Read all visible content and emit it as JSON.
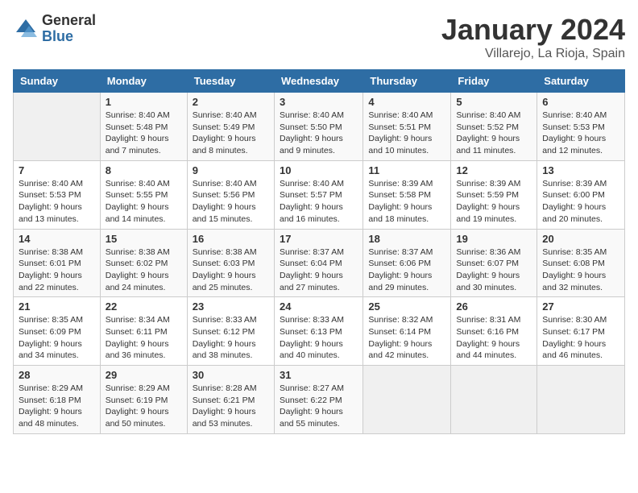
{
  "logo": {
    "general": "General",
    "blue": "Blue"
  },
  "title": "January 2024",
  "location": "Villarejo, La Rioja, Spain",
  "days_of_week": [
    "Sunday",
    "Monday",
    "Tuesday",
    "Wednesday",
    "Thursday",
    "Friday",
    "Saturday"
  ],
  "weeks": [
    [
      {
        "day": "",
        "sunrise": "",
        "sunset": "",
        "daylight": ""
      },
      {
        "day": "1",
        "sunrise": "Sunrise: 8:40 AM",
        "sunset": "Sunset: 5:48 PM",
        "daylight": "Daylight: 9 hours and 7 minutes."
      },
      {
        "day": "2",
        "sunrise": "Sunrise: 8:40 AM",
        "sunset": "Sunset: 5:49 PM",
        "daylight": "Daylight: 9 hours and 8 minutes."
      },
      {
        "day": "3",
        "sunrise": "Sunrise: 8:40 AM",
        "sunset": "Sunset: 5:50 PM",
        "daylight": "Daylight: 9 hours and 9 minutes."
      },
      {
        "day": "4",
        "sunrise": "Sunrise: 8:40 AM",
        "sunset": "Sunset: 5:51 PM",
        "daylight": "Daylight: 9 hours and 10 minutes."
      },
      {
        "day": "5",
        "sunrise": "Sunrise: 8:40 AM",
        "sunset": "Sunset: 5:52 PM",
        "daylight": "Daylight: 9 hours and 11 minutes."
      },
      {
        "day": "6",
        "sunrise": "Sunrise: 8:40 AM",
        "sunset": "Sunset: 5:53 PM",
        "daylight": "Daylight: 9 hours and 12 minutes."
      }
    ],
    [
      {
        "day": "7",
        "sunrise": "Sunrise: 8:40 AM",
        "sunset": "Sunset: 5:53 PM",
        "daylight": "Daylight: 9 hours and 13 minutes."
      },
      {
        "day": "8",
        "sunrise": "Sunrise: 8:40 AM",
        "sunset": "Sunset: 5:55 PM",
        "daylight": "Daylight: 9 hours and 14 minutes."
      },
      {
        "day": "9",
        "sunrise": "Sunrise: 8:40 AM",
        "sunset": "Sunset: 5:56 PM",
        "daylight": "Daylight: 9 hours and 15 minutes."
      },
      {
        "day": "10",
        "sunrise": "Sunrise: 8:40 AM",
        "sunset": "Sunset: 5:57 PM",
        "daylight": "Daylight: 9 hours and 16 minutes."
      },
      {
        "day": "11",
        "sunrise": "Sunrise: 8:39 AM",
        "sunset": "Sunset: 5:58 PM",
        "daylight": "Daylight: 9 hours and 18 minutes."
      },
      {
        "day": "12",
        "sunrise": "Sunrise: 8:39 AM",
        "sunset": "Sunset: 5:59 PM",
        "daylight": "Daylight: 9 hours and 19 minutes."
      },
      {
        "day": "13",
        "sunrise": "Sunrise: 8:39 AM",
        "sunset": "Sunset: 6:00 PM",
        "daylight": "Daylight: 9 hours and 20 minutes."
      }
    ],
    [
      {
        "day": "14",
        "sunrise": "Sunrise: 8:38 AM",
        "sunset": "Sunset: 6:01 PM",
        "daylight": "Daylight: 9 hours and 22 minutes."
      },
      {
        "day": "15",
        "sunrise": "Sunrise: 8:38 AM",
        "sunset": "Sunset: 6:02 PM",
        "daylight": "Daylight: 9 hours and 24 minutes."
      },
      {
        "day": "16",
        "sunrise": "Sunrise: 8:38 AM",
        "sunset": "Sunset: 6:03 PM",
        "daylight": "Daylight: 9 hours and 25 minutes."
      },
      {
        "day": "17",
        "sunrise": "Sunrise: 8:37 AM",
        "sunset": "Sunset: 6:04 PM",
        "daylight": "Daylight: 9 hours and 27 minutes."
      },
      {
        "day": "18",
        "sunrise": "Sunrise: 8:37 AM",
        "sunset": "Sunset: 6:06 PM",
        "daylight": "Daylight: 9 hours and 29 minutes."
      },
      {
        "day": "19",
        "sunrise": "Sunrise: 8:36 AM",
        "sunset": "Sunset: 6:07 PM",
        "daylight": "Daylight: 9 hours and 30 minutes."
      },
      {
        "day": "20",
        "sunrise": "Sunrise: 8:35 AM",
        "sunset": "Sunset: 6:08 PM",
        "daylight": "Daylight: 9 hours and 32 minutes."
      }
    ],
    [
      {
        "day": "21",
        "sunrise": "Sunrise: 8:35 AM",
        "sunset": "Sunset: 6:09 PM",
        "daylight": "Daylight: 9 hours and 34 minutes."
      },
      {
        "day": "22",
        "sunrise": "Sunrise: 8:34 AM",
        "sunset": "Sunset: 6:11 PM",
        "daylight": "Daylight: 9 hours and 36 minutes."
      },
      {
        "day": "23",
        "sunrise": "Sunrise: 8:33 AM",
        "sunset": "Sunset: 6:12 PM",
        "daylight": "Daylight: 9 hours and 38 minutes."
      },
      {
        "day": "24",
        "sunrise": "Sunrise: 8:33 AM",
        "sunset": "Sunset: 6:13 PM",
        "daylight": "Daylight: 9 hours and 40 minutes."
      },
      {
        "day": "25",
        "sunrise": "Sunrise: 8:32 AM",
        "sunset": "Sunset: 6:14 PM",
        "daylight": "Daylight: 9 hours and 42 minutes."
      },
      {
        "day": "26",
        "sunrise": "Sunrise: 8:31 AM",
        "sunset": "Sunset: 6:16 PM",
        "daylight": "Daylight: 9 hours and 44 minutes."
      },
      {
        "day": "27",
        "sunrise": "Sunrise: 8:30 AM",
        "sunset": "Sunset: 6:17 PM",
        "daylight": "Daylight: 9 hours and 46 minutes."
      }
    ],
    [
      {
        "day": "28",
        "sunrise": "Sunrise: 8:29 AM",
        "sunset": "Sunset: 6:18 PM",
        "daylight": "Daylight: 9 hours and 48 minutes."
      },
      {
        "day": "29",
        "sunrise": "Sunrise: 8:29 AM",
        "sunset": "Sunset: 6:19 PM",
        "daylight": "Daylight: 9 hours and 50 minutes."
      },
      {
        "day": "30",
        "sunrise": "Sunrise: 8:28 AM",
        "sunset": "Sunset: 6:21 PM",
        "daylight": "Daylight: 9 hours and 53 minutes."
      },
      {
        "day": "31",
        "sunrise": "Sunrise: 8:27 AM",
        "sunset": "Sunset: 6:22 PM",
        "daylight": "Daylight: 9 hours and 55 minutes."
      },
      {
        "day": "",
        "sunrise": "",
        "sunset": "",
        "daylight": ""
      },
      {
        "day": "",
        "sunrise": "",
        "sunset": "",
        "daylight": ""
      },
      {
        "day": "",
        "sunrise": "",
        "sunset": "",
        "daylight": ""
      }
    ]
  ]
}
